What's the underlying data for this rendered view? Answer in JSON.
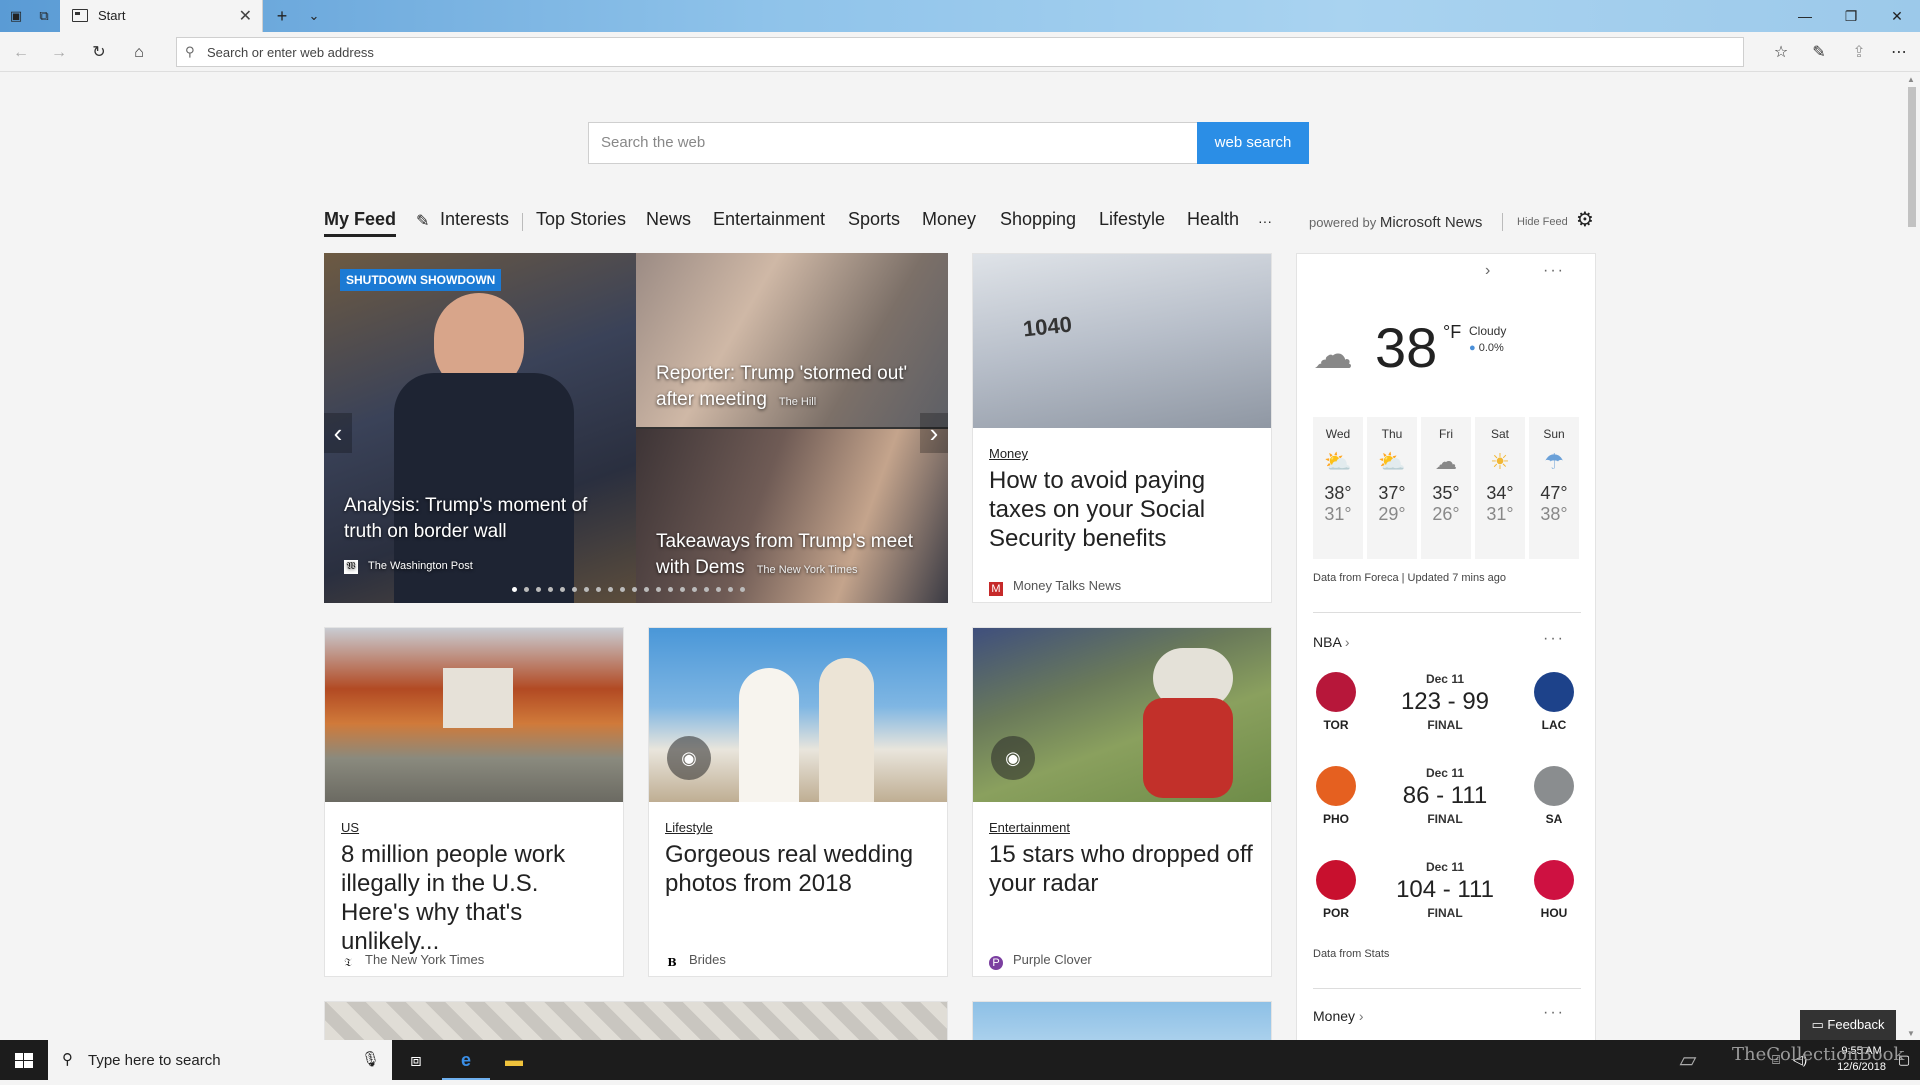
{
  "browser": {
    "tab_title": "Start",
    "address_placeholder": "Search or enter web address"
  },
  "search": {
    "placeholder": "Search the web",
    "button_label": "web search"
  },
  "feed_nav": {
    "items": [
      "My Feed",
      "Interests",
      "Top Stories",
      "News",
      "Entertainment",
      "Sports",
      "Money",
      "Shopping",
      "Lifestyle",
      "Health",
      "···"
    ],
    "powered_prefix": "powered by",
    "powered_brand": "Microsoft News",
    "hide_feed": "Hide Feed"
  },
  "hero": {
    "badge": "SHUTDOWN SHOWDOWN",
    "main_title": "Analysis: Trump's moment of truth on border wall",
    "main_source": "The Washington Post",
    "top_right_title": "Reporter: Trump 'stormed out' after meeting",
    "top_right_source": "The Hill",
    "bottom_right_title": "Takeaways from Trump's meet with Dems",
    "bottom_right_source": "The New York Times",
    "dot_count": 21
  },
  "cards": [
    {
      "category": "Money",
      "title": "How to avoid paying taxes on your Social Security benefits",
      "source": "Money Talks News"
    },
    {
      "category": "US",
      "title": "8 million people work illegally in the U.S. Here's why that's unlikely...",
      "source": "The New York Times"
    },
    {
      "category": "Lifestyle",
      "title": "Gorgeous real wedding photos from 2018",
      "source": "Brides"
    },
    {
      "category": "Entertainment",
      "title": "15 stars who dropped off your radar",
      "source": "Purple Clover"
    }
  ],
  "weather": {
    "temp": "38",
    "unit": "°F",
    "condition": "Cloudy",
    "precip": "0.0%",
    "forecast": [
      {
        "day": "Wed",
        "hi": "38°",
        "lo": "31°",
        "icon": "partly-sunny-icon"
      },
      {
        "day": "Thu",
        "hi": "37°",
        "lo": "29°",
        "icon": "partly-sunny-icon"
      },
      {
        "day": "Fri",
        "hi": "35°",
        "lo": "26°",
        "icon": "cloudy-icon"
      },
      {
        "day": "Sat",
        "hi": "34°",
        "lo": "31°",
        "icon": "sunny-icon"
      },
      {
        "day": "Sun",
        "hi": "47°",
        "lo": "38°",
        "icon": "rain-icon"
      }
    ],
    "credit": "Data from Foreca | Updated 7 mins ago"
  },
  "nba": {
    "title": "NBA",
    "games": [
      {
        "date": "Dec 11",
        "score": "123 - 99",
        "status": "FINAL",
        "home": "TOR",
        "away": "LAC"
      },
      {
        "date": "Dec 11",
        "score": "86 - 111",
        "status": "FINAL",
        "home": "PHO",
        "away": "SA"
      },
      {
        "date": "Dec 11",
        "score": "104 - 111",
        "status": "FINAL",
        "home": "POR",
        "away": "HOU"
      }
    ],
    "credit": "Data from Stats"
  },
  "money_section": "Money",
  "feedback": "Feedback",
  "taskbar": {
    "search_placeholder": "Type here to search",
    "time": "9:55 AM",
    "date": "12/6/2018"
  },
  "watermark": "TheCollectionBook"
}
